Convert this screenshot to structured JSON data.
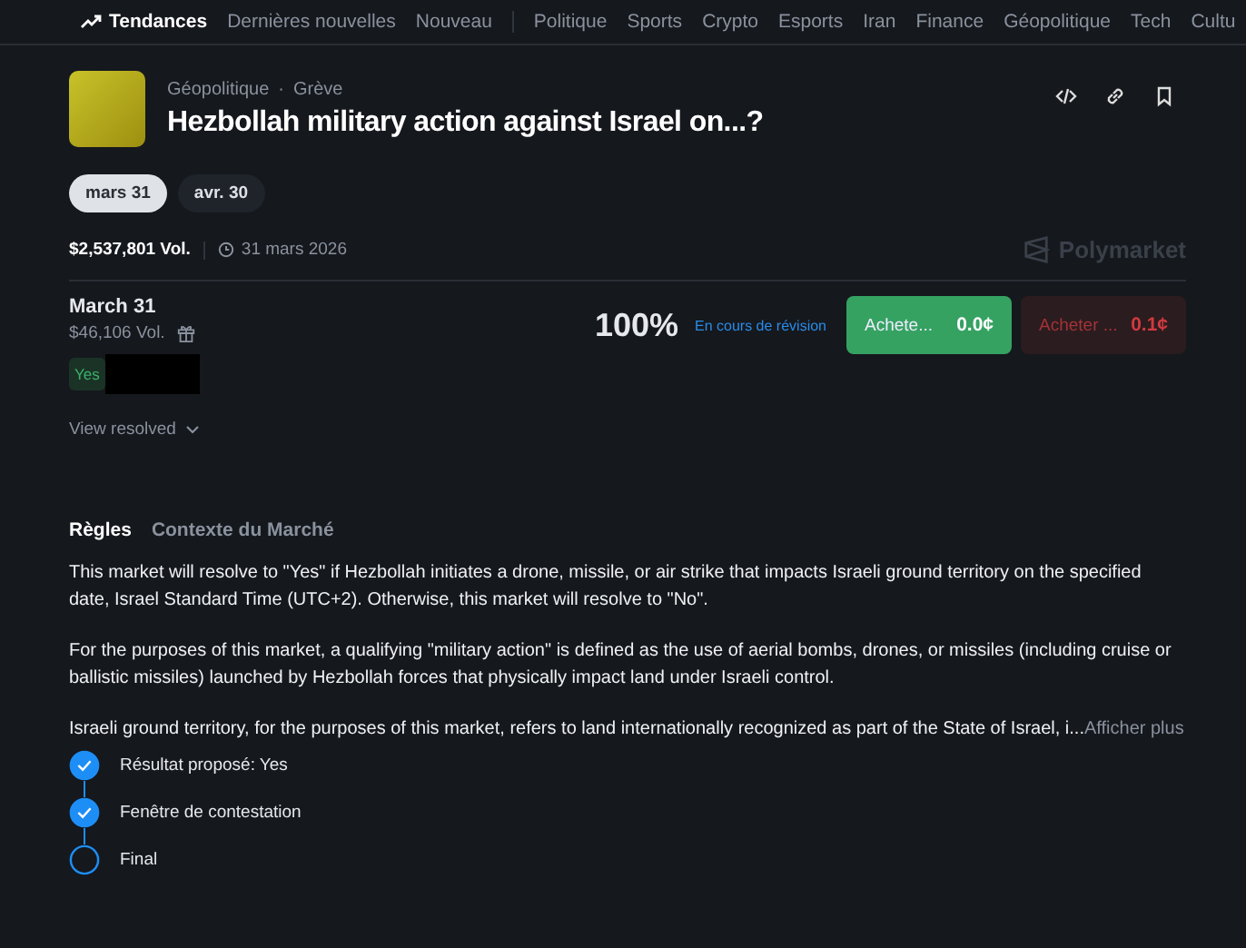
{
  "nav": {
    "items": [
      {
        "label": "Tendances",
        "selected": true,
        "kind": "trending"
      },
      {
        "label": "Dernières nouvelles",
        "selected": false,
        "kind": "link"
      },
      {
        "label": "Nouveau",
        "selected": false,
        "kind": "link"
      },
      {
        "label": "Politique",
        "selected": false,
        "kind": "category"
      },
      {
        "label": "Sports",
        "selected": false,
        "kind": "category"
      },
      {
        "label": "Crypto",
        "selected": false,
        "kind": "category"
      },
      {
        "label": "Esports",
        "selected": false,
        "kind": "category"
      },
      {
        "label": "Iran",
        "selected": false,
        "kind": "category"
      },
      {
        "label": "Finance",
        "selected": false,
        "kind": "category"
      },
      {
        "label": "Géopolitique",
        "selected": false,
        "kind": "category"
      },
      {
        "label": "Tech",
        "selected": false,
        "kind": "category"
      },
      {
        "label": "Cultu",
        "selected": false,
        "kind": "category"
      }
    ]
  },
  "event": {
    "breadcrumb": [
      "Géopolitique",
      "Grève"
    ],
    "breadcrumb_separator": "·",
    "title": "Hezbollah military action against Israel on...?"
  },
  "date_tabs": [
    {
      "label": "mars 31",
      "selected": true
    },
    {
      "label": "avr. 30",
      "selected": false
    }
  ],
  "summary": {
    "volume": "$2,537,801 Vol.",
    "end_date": "31 mars 2026",
    "brand": "Polymarket"
  },
  "market": {
    "name": "March 31",
    "volume": "$46,106 Vol.",
    "outcome_tag": "Yes",
    "probability": "100%",
    "status": "En cours de révision",
    "buy_yes": {
      "label": "Achete...",
      "price": "0.0¢"
    },
    "buy_no": {
      "label": "Acheter ...",
      "price": "0.1¢"
    }
  },
  "view_resolved": "View resolved",
  "rules_tabs": [
    {
      "label": "Règles",
      "selected": true
    },
    {
      "label": "Contexte du Marché",
      "selected": false
    }
  ],
  "rules": [
    "This market will resolve to \"Yes\" if Hezbollah initiates a drone, missile, or air strike that impacts Israeli ground territory on the specified date, Israel Standard Time (UTC+2). Otherwise, this market will resolve to \"No\".",
    "For the purposes of this market, a qualifying \"military action\" is defined as the use of aerial bombs, drones, or missiles (including cruise or ballistic missiles) launched by Hezbollah forces that physically impact land under Israeli control.",
    "Israeli ground territory, for the purposes of this market, refers to land internationally recognized as part of the State of Israel, i..."
  ],
  "show_more": "Afficher plus",
  "steps": [
    {
      "label": "Résultat proposé: Yes",
      "checked": true
    },
    {
      "label": "Fenêtre de contestation",
      "checked": true
    },
    {
      "label": "Final",
      "checked": false
    }
  ]
}
